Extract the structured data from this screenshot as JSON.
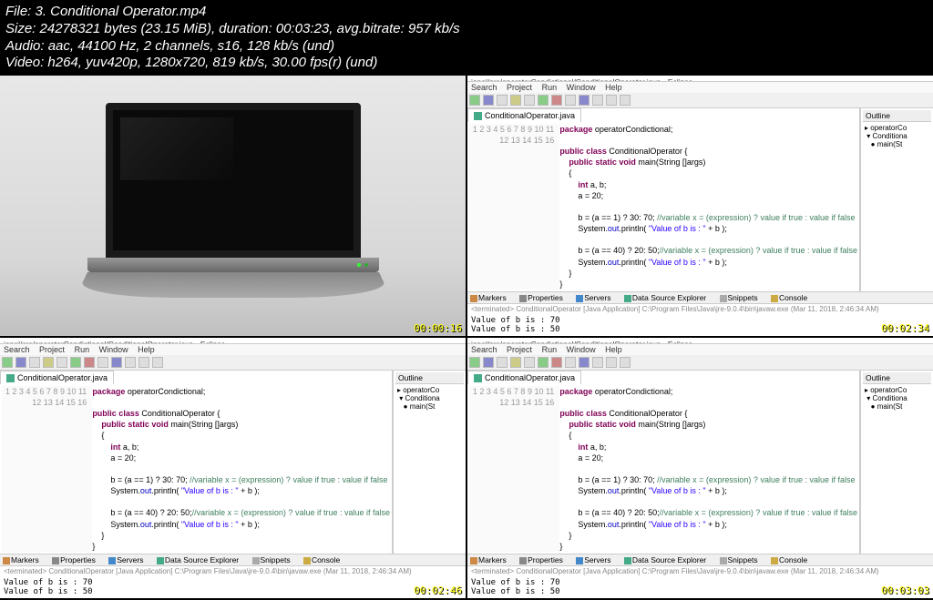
{
  "header": {
    "file": "File: 3. Conditional Operator.mp4",
    "size": "Size: 24278321 bytes (23.15 MiB), duration: 00:03:23, avg.bitrate: 957 kb/s",
    "audio": "Audio: aac, 44100 Hz, 2 channels, s16, 128 kb/s (und)",
    "video": "Video: h264, yuv420p, 1280x720, 819 kb/s, 30.00 fps(r) (und)"
  },
  "timestamps": {
    "tl": "00:00:16",
    "tr": "00:02:34",
    "bl": "00:02:46",
    "br": "00:03:03"
  },
  "eclipse": {
    "title": "ional/src/operatorCondictional/ConditionalOperator.java - Eclipse",
    "menu": [
      "Search",
      "Project",
      "Run",
      "Window",
      "Help"
    ],
    "tab": "ConditionalOperator.java",
    "outline_title": "Outline",
    "outline_items": [
      "operatorCo",
      "Conditiona",
      "main(St"
    ],
    "console_tabs": [
      "Markers",
      "Properties",
      "Servers",
      "Data Source Explorer",
      "Snippets",
      "Console"
    ],
    "console_info": "<terminated> ConditionalOperator [Java Application] C:\\Program Files\\Java\\jre-9.0.4\\bin\\javaw.exe (Mar 11, 2018, 2:46:34 AM)",
    "console_out": "Value of b is : 70\nValue of b is : 50"
  },
  "code": {
    "lineno": "1\n2\n3\n4\n5\n6\n7\n8\n9\n10\n11\n12\n13\n14\n15\n16",
    "package_kw": "package",
    "package_name": " operatorCondictional;",
    "class_decl1": "public class",
    "class_name": " ConditionalOperator {",
    "main_decl": "    public static void",
    "main_sig": " main(String []args)",
    "brace_open": "    {",
    "var_decl": "        int",
    "var_names": " a, b;",
    "assign_a": "        a = 20;",
    "empty": "",
    "b1a": "        b = (a == 1) ? 30: 70; ",
    "b1c": "//variable x = (expression) ? value if true : value if false",
    "p1a": "        System.",
    "p1b": "out",
    "p1c": ".println( ",
    "p1d": "\"Value of b is : \"",
    "p1e": " + b );",
    "b2a": "        b = (a == 40) ? 20: 50;",
    "b2c": "//variable x = (expression) ? value if true : value if false",
    "p2a": "        System.",
    "p2b": "out",
    "p2c": ".println( ",
    "p2d": "\"Value of b is : \"",
    "p2e": " + b );",
    "brace_close1": "    }",
    "brace_close2": "}"
  }
}
